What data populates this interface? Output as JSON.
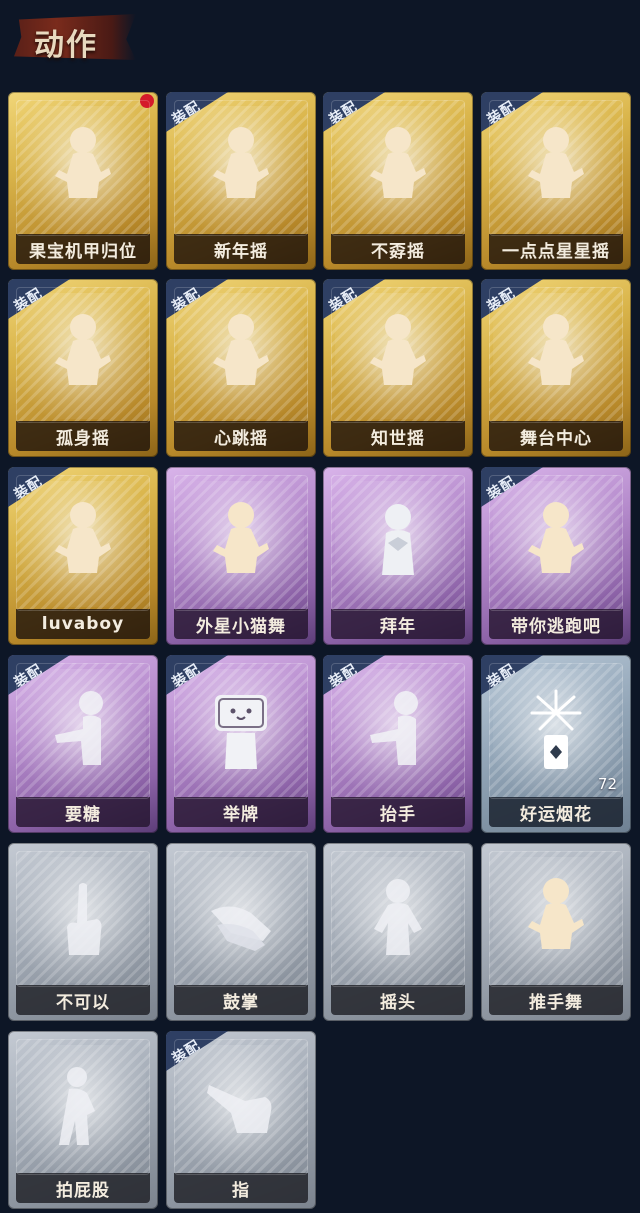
{
  "header": {
    "title": "动作"
  },
  "equip_label": "装配",
  "colors": {
    "background": "#0d1626",
    "gold_card": "#d9b44a",
    "purple_card": "#b58bcc",
    "blue_card": "#93a6b8",
    "grey_card": "#a3abb6",
    "equip_tag": "#2e3f63",
    "new_dot": "#d41a2a"
  },
  "cards": [
    {
      "label": "果宝机甲归位",
      "rarity": "gold",
      "equipped": false,
      "new_dot": true,
      "icon": "figure-dance-icon"
    },
    {
      "label": "新年摇",
      "rarity": "gold",
      "equipped": true,
      "icon": "figure-dance-icon"
    },
    {
      "label": "不孬摇",
      "rarity": "gold",
      "equipped": true,
      "icon": "figure-dance-icon"
    },
    {
      "label": "一点点星星摇",
      "rarity": "gold",
      "equipped": true,
      "icon": "figure-dance-icon"
    },
    {
      "label": "孤身摇",
      "rarity": "gold",
      "equipped": true,
      "icon": "figure-dance-icon"
    },
    {
      "label": "心跳摇",
      "rarity": "gold",
      "equipped": true,
      "icon": "figure-dance-icon"
    },
    {
      "label": "知世摇",
      "rarity": "gold",
      "equipped": true,
      "icon": "figure-dance-icon"
    },
    {
      "label": "舞台中心",
      "rarity": "gold",
      "equipped": true,
      "icon": "figure-dance-icon"
    },
    {
      "label": "luvaboy",
      "rarity": "gold",
      "equipped": true,
      "icon": "figure-dance-icon"
    },
    {
      "label": "外星小猫舞",
      "rarity": "purple",
      "equipped": false,
      "icon": "figure-dance-icon"
    },
    {
      "label": "拜年",
      "rarity": "purple",
      "equipped": false,
      "icon": "figure-greet-icon"
    },
    {
      "label": "带你逃跑吧",
      "rarity": "purple",
      "equipped": true,
      "icon": "figure-dance-icon"
    },
    {
      "label": "要糖",
      "rarity": "purple",
      "equipped": true,
      "icon": "figure-reach-icon"
    },
    {
      "label": "举牌",
      "rarity": "purple",
      "equipped": true,
      "icon": "figure-sign-icon"
    },
    {
      "label": "抬手",
      "rarity": "purple",
      "equipped": true,
      "icon": "figure-reach-icon"
    },
    {
      "label": "好运烟花",
      "rarity": "blue",
      "equipped": true,
      "icon": "firework-icon",
      "count": "72"
    },
    {
      "label": "不可以",
      "rarity": "grey",
      "equipped": false,
      "icon": "finger-wag-icon"
    },
    {
      "label": "鼓掌",
      "rarity": "grey",
      "equipped": false,
      "icon": "clap-hands-icon"
    },
    {
      "label": "摇头",
      "rarity": "grey",
      "equipped": false,
      "icon": "figure-shake-icon"
    },
    {
      "label": "推手舞",
      "rarity": "grey",
      "equipped": false,
      "icon": "figure-dance-icon"
    },
    {
      "label": "拍屁股",
      "rarity": "grey",
      "equipped": false,
      "icon": "figure-slap-icon"
    },
    {
      "label": "指",
      "rarity": "grey",
      "equipped": true,
      "icon": "point-hand-icon"
    }
  ]
}
